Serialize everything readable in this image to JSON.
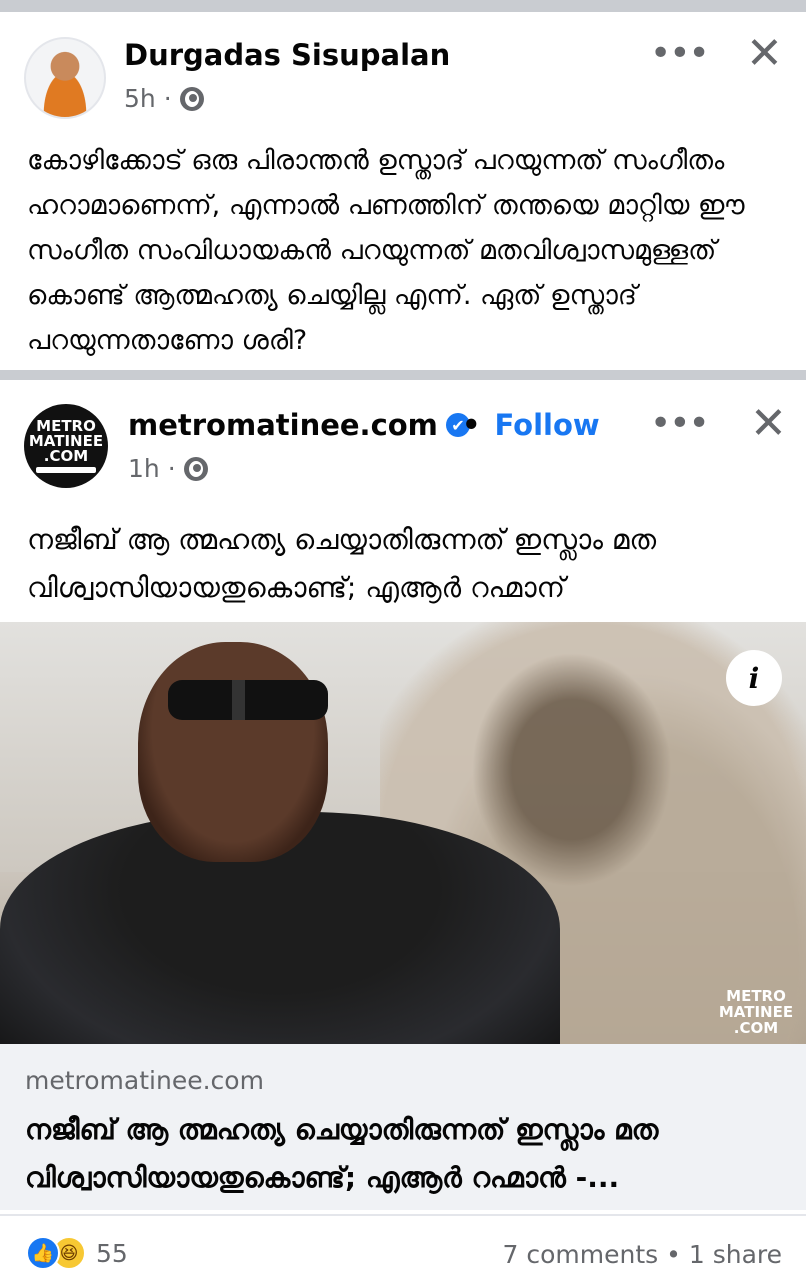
{
  "post": {
    "author": "Durgadas Sisupalan",
    "time": "5h",
    "time_separator": "·",
    "privacy_icon": "globe-icon",
    "more_icon": "•••",
    "close_icon": "✕",
    "text": "കോഴിക്കോട് ഒരു പിരാന്തൻ ഉസ്താദ് പറയുന്നത് സംഗീതം ഹറാമാണെന്ന്, എന്നാൽ പണത്തിന് തന്തയെ മാറ്റിയ ഈ സംഗീത സംവിധായകൻ പറയുന്നത് മതവിശ്വാസമുള്ളത് കൊണ്ട് ആത്മഹത്യ ചെയ്യില്ല എന്ന്. ഏത് ഉസ്താദ് പറയുന്നതാണോ ശരി?"
  },
  "shared": {
    "page_logo_lines": [
      "METRO",
      "MATINEE",
      ".COM"
    ],
    "page_name": "metromatinee.com",
    "verified_icon": "✔",
    "follow_separator": "•",
    "follow_label": "Follow",
    "time": "1h",
    "time_separator": "·",
    "more_icon": "•••",
    "close_icon": "✕",
    "text": "നജീബ് ആ ത്മഹത്യ ചെയ്യാതിരുന്നത് ഇസ്ലാം മത വിശ്വാസിയായതുകൊണ്ട്; എആർ റഹ്മാന്",
    "info_label": "i",
    "watermark_lines": [
      "METRO",
      "MATINEE",
      ".COM"
    ]
  },
  "link_preview": {
    "domain": "metromatinee.com",
    "title": "നജീബ് ആ ത്മഹത്യ ചെയ്യാതിരുന്നത് ഇസ്ലാം മത വിശ്വാസിയായതുകൊണ്ട്; എആർ റഹ്മാൻ -..."
  },
  "footer": {
    "reaction_icons": [
      "like-icon",
      "haha-icon"
    ],
    "reaction_count": "55",
    "comments": "7 comments",
    "separator": "•",
    "shares": "1 share"
  },
  "colors": {
    "accent": "#1877f2",
    "secondary_text": "#65676b",
    "divider": "#c9ccd1",
    "link_box_bg": "#f0f2f5"
  }
}
